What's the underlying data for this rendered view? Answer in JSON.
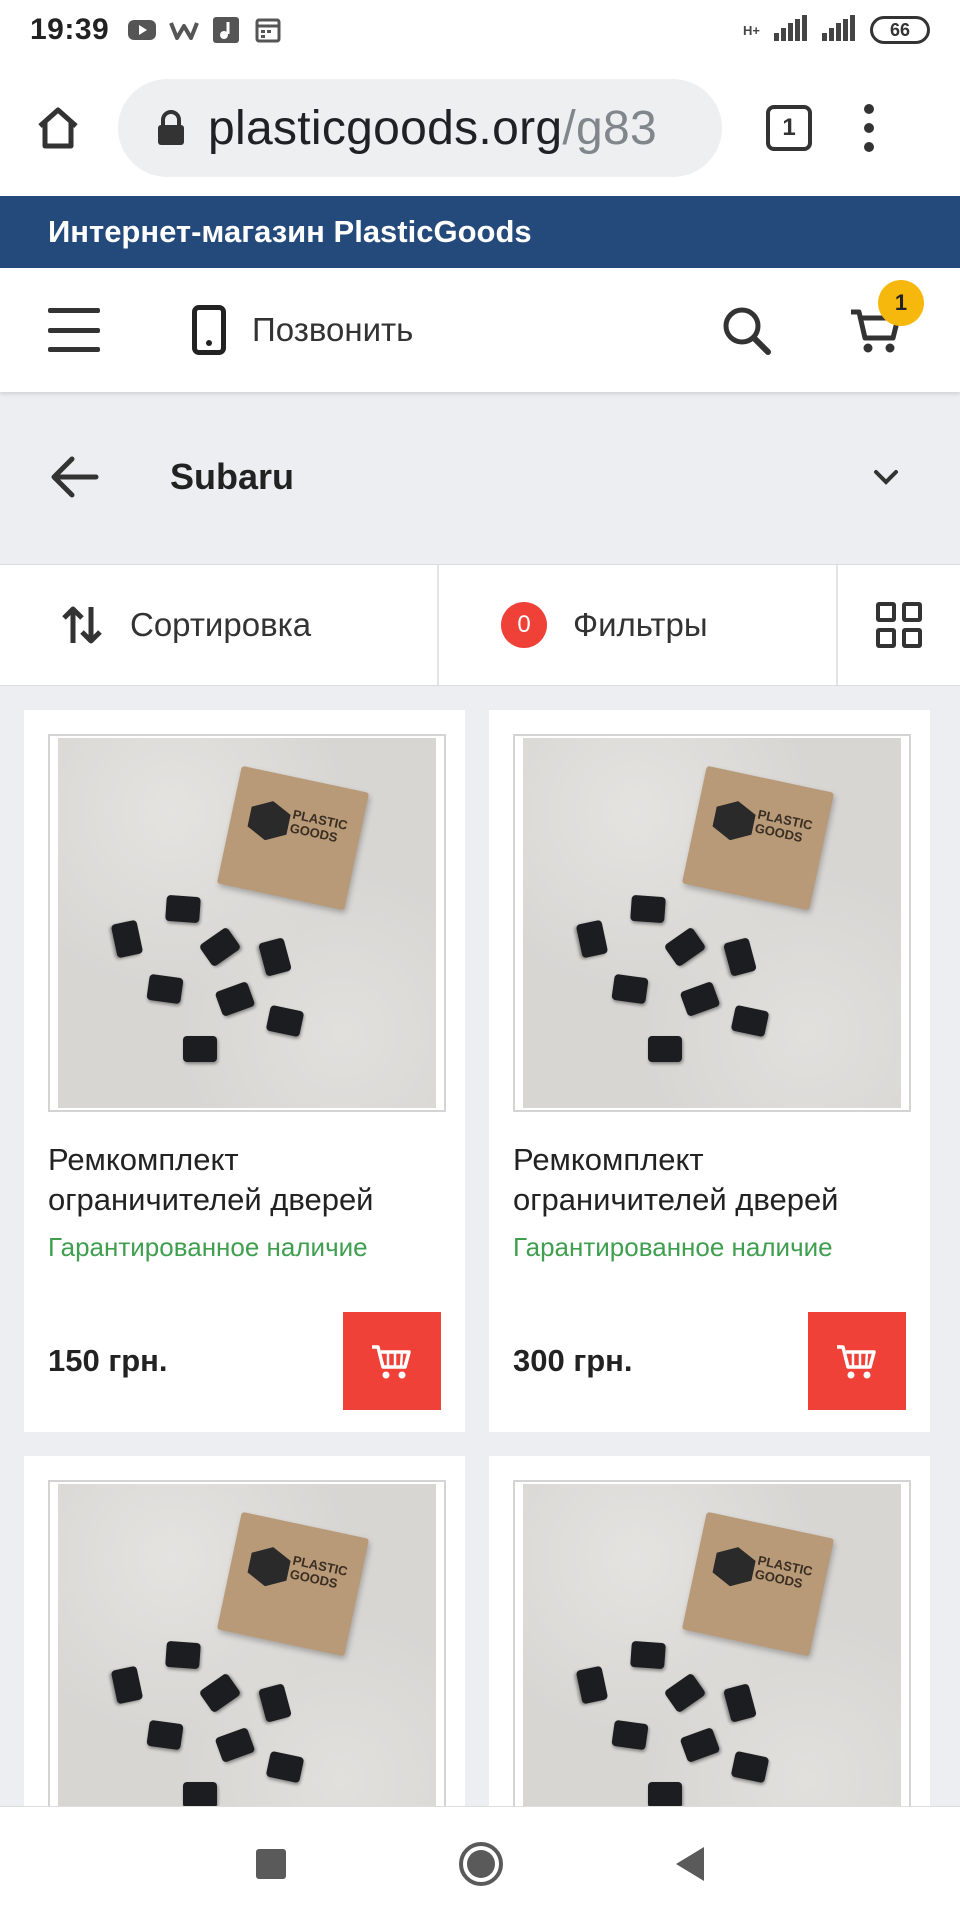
{
  "status_bar": {
    "time": "19:39",
    "network": "H+",
    "battery": "66",
    "left_icons": [
      "youtube-icon",
      "w-app-icon",
      "music-icon",
      "calendar-icon"
    ],
    "right_icons": [
      "signal-icon",
      "signal-icon"
    ]
  },
  "browser": {
    "url_main": "plasticgoods.org",
    "url_rest": "/g83",
    "tab_count": "1",
    "icons": [
      "home-icon",
      "lock-icon",
      "tabs-icon",
      "more-vert-icon"
    ]
  },
  "store": {
    "banner": "Интернет-магазин PlasticGoods"
  },
  "header": {
    "call_label": "Позвонить",
    "cart_count": "1",
    "badge_color": "#f6b80c",
    "icons": [
      "menu-icon",
      "phone-icon",
      "search-icon",
      "cart-icon"
    ]
  },
  "category": {
    "title": "Subaru"
  },
  "toolbar": {
    "sort_label": "Сортировка",
    "filter_count": "0",
    "filter_label": "Фильтры",
    "accent_color": "#ef4138"
  },
  "products": [
    {
      "title": "Ремкомплект ограничителей дверей",
      "stock": "Гарантированное наличие",
      "price": "150 грн."
    },
    {
      "title": "Ремкомплект ограничителей дверей",
      "stock": "Гарантированное наличие",
      "price": "300 грн."
    },
    {
      "title": "",
      "stock": "",
      "price": ""
    },
    {
      "title": "",
      "stock": "",
      "price": ""
    }
  ],
  "image_box_text": "PLASTIC GOODS",
  "colors": {
    "banner": "#244a7c",
    "stock_green": "#3f9f4f",
    "cart_button": "#ef4138"
  },
  "nav": {
    "icons": [
      "recent-apps-icon",
      "home-circle-icon",
      "back-triangle-icon"
    ]
  }
}
